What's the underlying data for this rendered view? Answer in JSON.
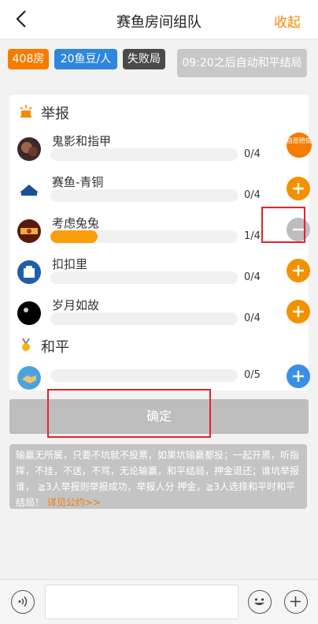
{
  "header": {
    "title": "赛鱼房间组队",
    "collapse_label": "收起"
  },
  "tags": {
    "room": "408房",
    "price": "20鱼豆/人",
    "mode": "失败局",
    "auto": "09:20之后自动和平结局"
  },
  "report_section": {
    "title": "举报",
    "players": [
      {
        "name": "鬼影和指甲",
        "count": "0/4",
        "progress": 0,
        "action": "badge",
        "badge_text": "自愿赔偿"
      },
      {
        "name": "赛鱼-青铜",
        "count": "0/4",
        "progress": 0,
        "action": "plus"
      },
      {
        "name": "考虑兔兔",
        "count": "1/4",
        "progress": 0.25,
        "action": "minus"
      },
      {
        "name": "扣扣里",
        "count": "0/4",
        "progress": 0,
        "action": "plus"
      },
      {
        "name": "岁月如故",
        "count": "0/4",
        "progress": 0,
        "action": "plus"
      }
    ]
  },
  "peace_section": {
    "title": "和平",
    "count": "0/5",
    "progress": 0
  },
  "confirm_label": "确定",
  "notice": {
    "text": "输赢无所属，只要不坑就不投票，如果坑输赢都投；一起开黑，听指挥，不挂，不送，不骂，无论输赢，和平结局，押金退还；谁坑举报谁， ≧3人举报则举报成功，举报人分 押金，≧3人选择和平时和平结局！",
    "link": "详见公约>>"
  },
  "input": {
    "value": ""
  },
  "colors": {
    "accent": "#f08a00",
    "progress": "#f99e0a",
    "blue": "#3b8ee8",
    "highlight": "#e8202a"
  }
}
